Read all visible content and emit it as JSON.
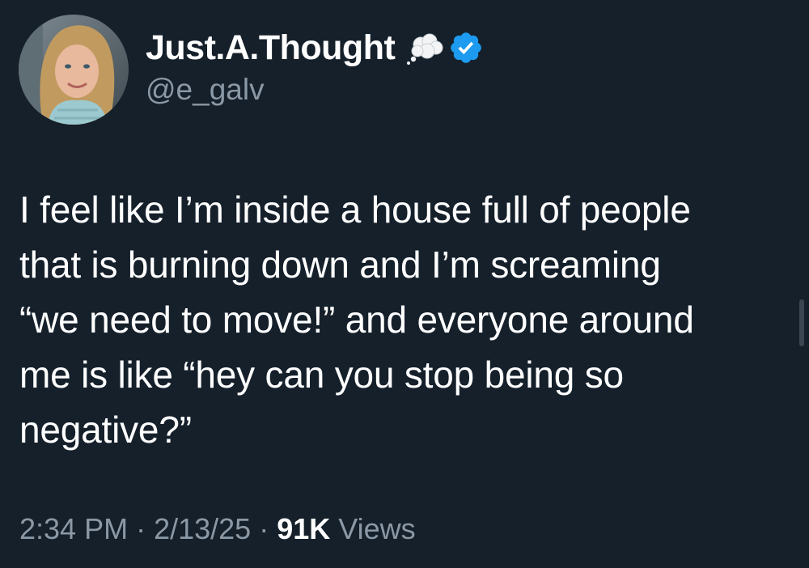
{
  "author": {
    "display_name": "Just.A.Thought",
    "handle": "@e_galv",
    "emoji_icon": "thought-balloon-icon",
    "verified_icon": "verified-badge-icon",
    "verified_color": "#1d9bf0"
  },
  "tweet": {
    "lines": [
      "I feel like I’m inside a house full of people",
      "that is burning down and I’m screaming",
      "“we need to move!” and everyone around",
      "me is like “hey can you stop being so",
      "negative?”"
    ]
  },
  "meta": {
    "time": "2:34 PM",
    "separator": " · ",
    "date": "2/13/25",
    "views_count": "91K",
    "views_label": " Views"
  },
  "colors": {
    "background": "#15202b",
    "secondary_text": "#8b98a5",
    "primary_text": "#ffffff"
  }
}
